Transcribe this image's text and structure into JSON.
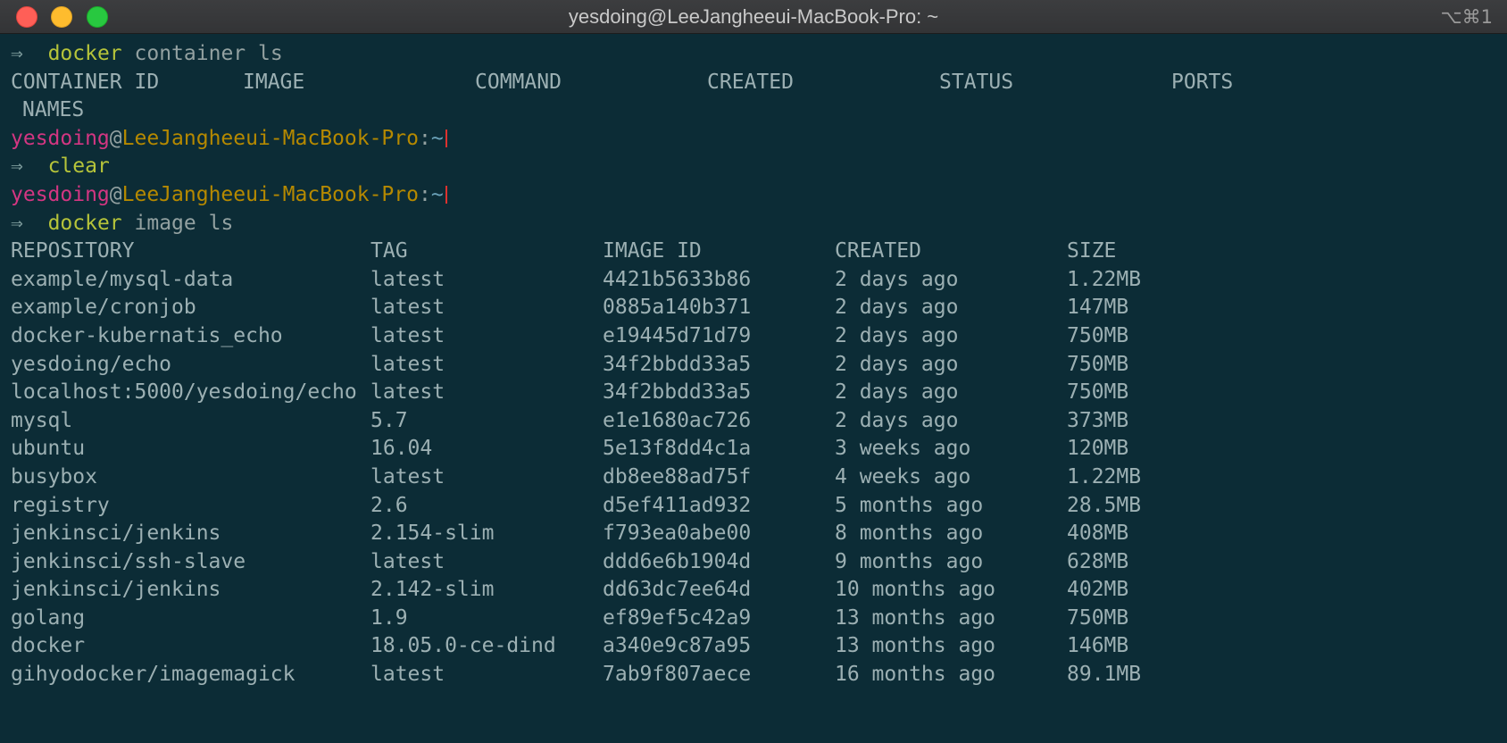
{
  "window": {
    "title": "yesdoing@LeeJangheeui-MacBook-Pro: ~",
    "shortcut": "⌥⌘1"
  },
  "prompt": {
    "symbol": "⇒",
    "user": "yesdoing",
    "at": "@",
    "host": "LeeJangheeui-MacBook-Pro",
    "colon": ":",
    "path": "~"
  },
  "commands": {
    "container_ls": {
      "cmd": "docker",
      "args": "container ls"
    },
    "clear": {
      "cmd": "clear"
    },
    "image_ls": {
      "cmd": "docker",
      "args": "image ls"
    }
  },
  "container_headers": [
    "CONTAINER ID",
    "IMAGE",
    "COMMAND",
    "CREATED",
    "STATUS",
    "PORTS"
  ],
  "container_headers_wrap": "NAMES",
  "image_headers": [
    "REPOSITORY",
    "TAG",
    "IMAGE ID",
    "CREATED",
    "SIZE"
  ],
  "image_rows": [
    [
      "example/mysql-data",
      "latest",
      "4421b5633b86",
      "2 days ago",
      "1.22MB"
    ],
    [
      "example/cronjob",
      "latest",
      "0885a140b371",
      "2 days ago",
      "147MB"
    ],
    [
      "docker-kubernatis_echo",
      "latest",
      "e19445d71d79",
      "2 days ago",
      "750MB"
    ],
    [
      "yesdoing/echo",
      "latest",
      "34f2bbdd33a5",
      "2 days ago",
      "750MB"
    ],
    [
      "localhost:5000/yesdoing/echo",
      "latest",
      "34f2bbdd33a5",
      "2 days ago",
      "750MB"
    ],
    [
      "mysql",
      "5.7",
      "e1e1680ac726",
      "2 days ago",
      "373MB"
    ],
    [
      "ubuntu",
      "16.04",
      "5e13f8dd4c1a",
      "3 weeks ago",
      "120MB"
    ],
    [
      "busybox",
      "latest",
      "db8ee88ad75f",
      "4 weeks ago",
      "1.22MB"
    ],
    [
      "registry",
      "2.6",
      "d5ef411ad932",
      "5 months ago",
      "28.5MB"
    ],
    [
      "jenkinsci/jenkins",
      "2.154-slim",
      "f793ea0abe00",
      "8 months ago",
      "408MB"
    ],
    [
      "jenkinsci/ssh-slave",
      "latest",
      "ddd6e6b1904d",
      "9 months ago",
      "628MB"
    ],
    [
      "jenkinsci/jenkins",
      "2.142-slim",
      "dd63dc7ee64d",
      "10 months ago",
      "402MB"
    ],
    [
      "golang",
      "1.9",
      "ef89ef5c42a9",
      "13 months ago",
      "750MB"
    ],
    [
      "docker",
      "18.05.0-ce-dind",
      "a340e9c87a95",
      "13 months ago",
      "146MB"
    ],
    [
      "gihyodocker/imagemagick",
      "latest",
      "7ab9f807aece",
      "16 months ago",
      "89.1MB"
    ]
  ]
}
